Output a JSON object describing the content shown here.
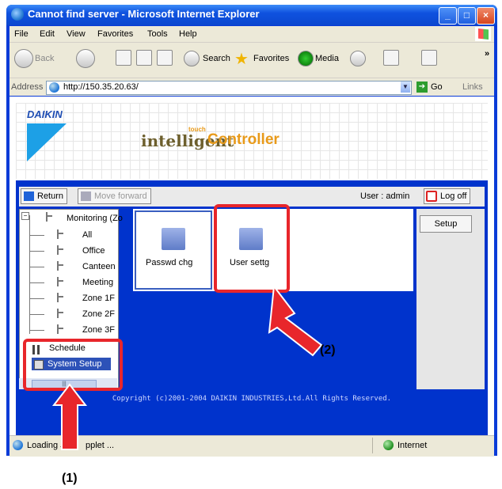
{
  "window": {
    "title": "Cannot find server - Microsoft Internet Explorer",
    "controls": [
      "_",
      "□",
      "×"
    ]
  },
  "menu": [
    "File",
    "Edit",
    "View",
    "Favorites",
    "Tools",
    "Help"
  ],
  "toolbar": {
    "back_label": "Back",
    "search_label": "Search",
    "favorites_label": "Favorites",
    "media_label": "Media",
    "overflow": "»"
  },
  "address": {
    "label": "Address",
    "url": "http://150.35.20.63/",
    "go_label": "Go",
    "links_label": "Links"
  },
  "banner": {
    "brand": "DAIKIN",
    "logo_main": "intelligent",
    "logo_touch": "touch",
    "logo_controller": "Controller"
  },
  "app": {
    "return_label": "Return",
    "move_forward_label": "Move forward",
    "user_label": "User : admin",
    "logoff_label": "Log off",
    "setup_label": "Setup",
    "tree": {
      "root": "Monitoring (Zo",
      "children": [
        "All",
        "Office",
        "Canteen",
        "Meeting",
        "Zone 1F",
        "Zone 2F",
        "Zone 3F"
      ],
      "schedule": "Schedule",
      "system_setup": "System Setup"
    },
    "tiles": {
      "passwd": "Passwd chg",
      "user": "User settg"
    },
    "copyright": "Copyright (c)2001-2004 DAIKIN INDUSTRIES,Ltd.All Rights Reserved."
  },
  "status": {
    "text": "Loading J",
    "text_tail": "pplet ...",
    "zone": "Internet"
  },
  "annotations": {
    "one": "(1)",
    "two": "(2)",
    "color": "#e8262b"
  }
}
